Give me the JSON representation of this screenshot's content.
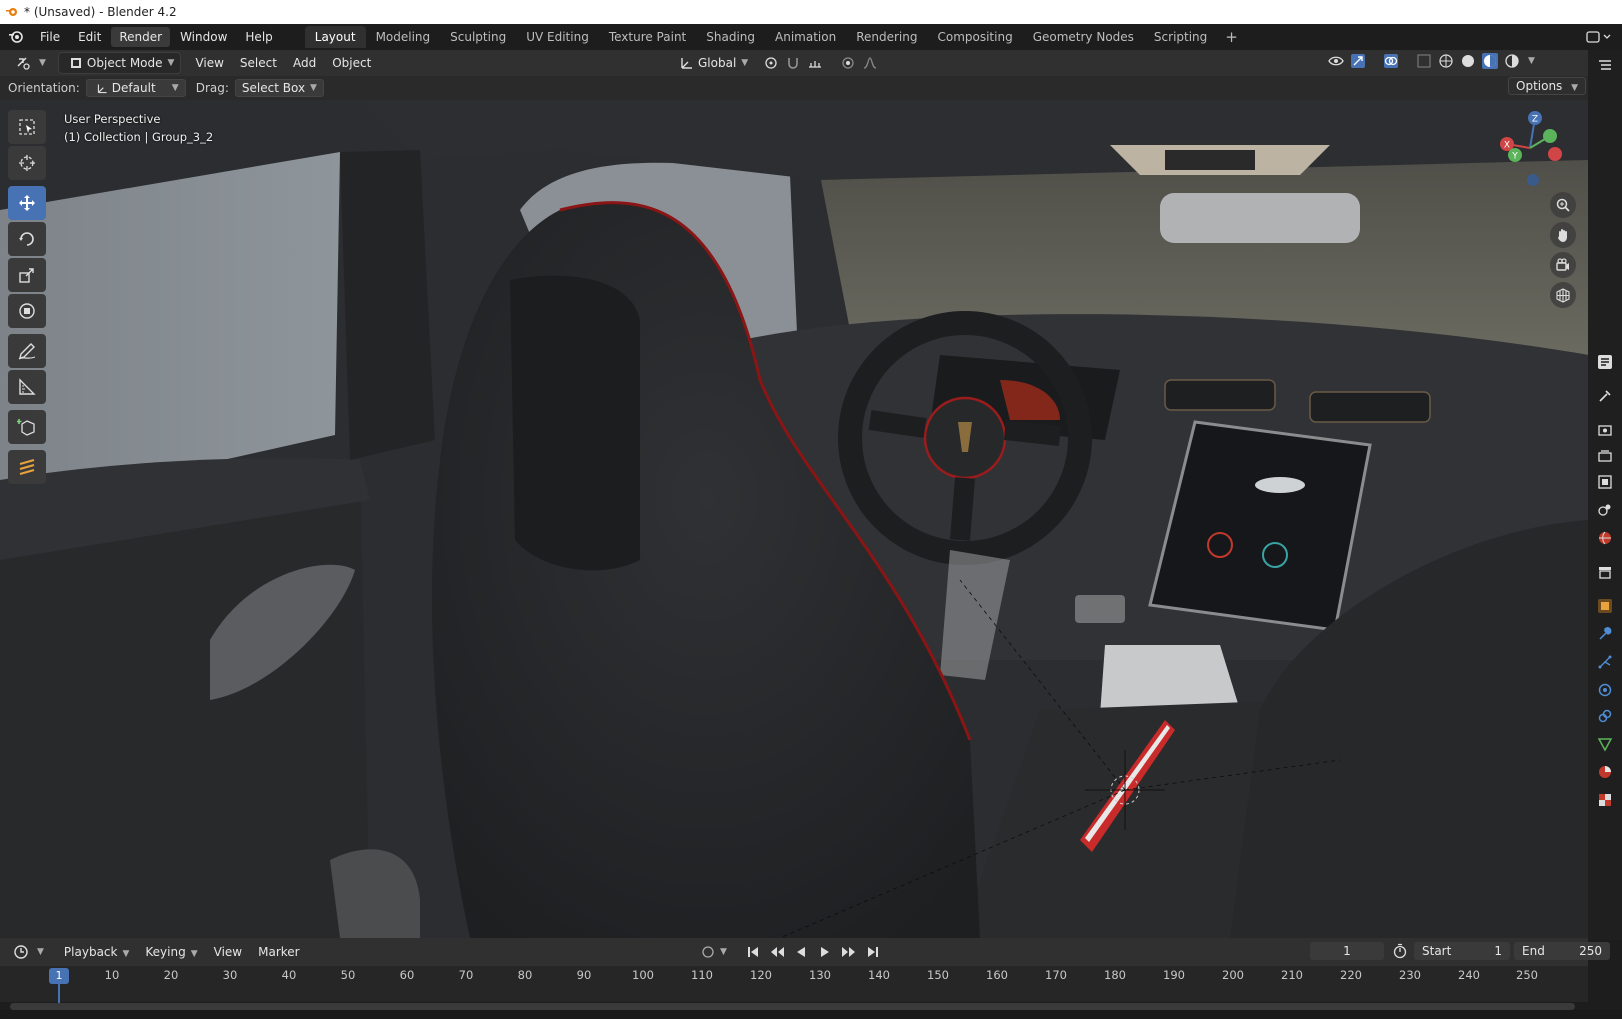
{
  "title_bar": {
    "title": "* (Unsaved) - Blender 4.2"
  },
  "menu": {
    "items": [
      "File",
      "Edit",
      "Render",
      "Window",
      "Help"
    ],
    "active": "Render"
  },
  "workspaces": {
    "tabs": [
      "Layout",
      "Modeling",
      "Sculpting",
      "UV Editing",
      "Texture Paint",
      "Shading",
      "Animation",
      "Rendering",
      "Compositing",
      "Geometry Nodes",
      "Scripting"
    ],
    "active": "Layout",
    "add_label": "+"
  },
  "viewport_header": {
    "mode": "Object Mode",
    "menus": [
      "View",
      "Select",
      "Add",
      "Object"
    ],
    "transform_orientation": "Global"
  },
  "tool_settings": {
    "orientation_label": "Orientation:",
    "orientation_value": "Default",
    "drag_label": "Drag:",
    "drag_value": "Select Box",
    "options_label": "Options"
  },
  "viewport": {
    "perspective": "User Perspective",
    "collection": "(1) Collection | Group_3_2"
  },
  "gizmo": {
    "z": "Z",
    "y": "Y",
    "x": "X"
  },
  "timeline": {
    "menus": [
      "Playback",
      "Keying",
      "View",
      "Marker"
    ],
    "current_frame": "1",
    "start_label": "Start",
    "start_value": "1",
    "end_label": "End",
    "end_value": "250",
    "ticks": [
      "10",
      "20",
      "30",
      "40",
      "50",
      "60",
      "70",
      "80",
      "90",
      "100",
      "110",
      "120",
      "130",
      "140",
      "150",
      "160",
      "170",
      "180",
      "190",
      "200",
      "210",
      "220",
      "230",
      "240",
      "250"
    ],
    "playhead_label": "1"
  },
  "icons": [
    "blender-logo-icon",
    "editor-type-icon",
    "object-mode-icon",
    "select-box-icon",
    "cursor-icon",
    "move-icon",
    "rotate-icon",
    "scale-icon",
    "transform-icon",
    "annotate-icon",
    "measure-icon",
    "add-cube-icon",
    "zoom-icon",
    "hand-icon",
    "camera-icon",
    "grid-icon"
  ]
}
